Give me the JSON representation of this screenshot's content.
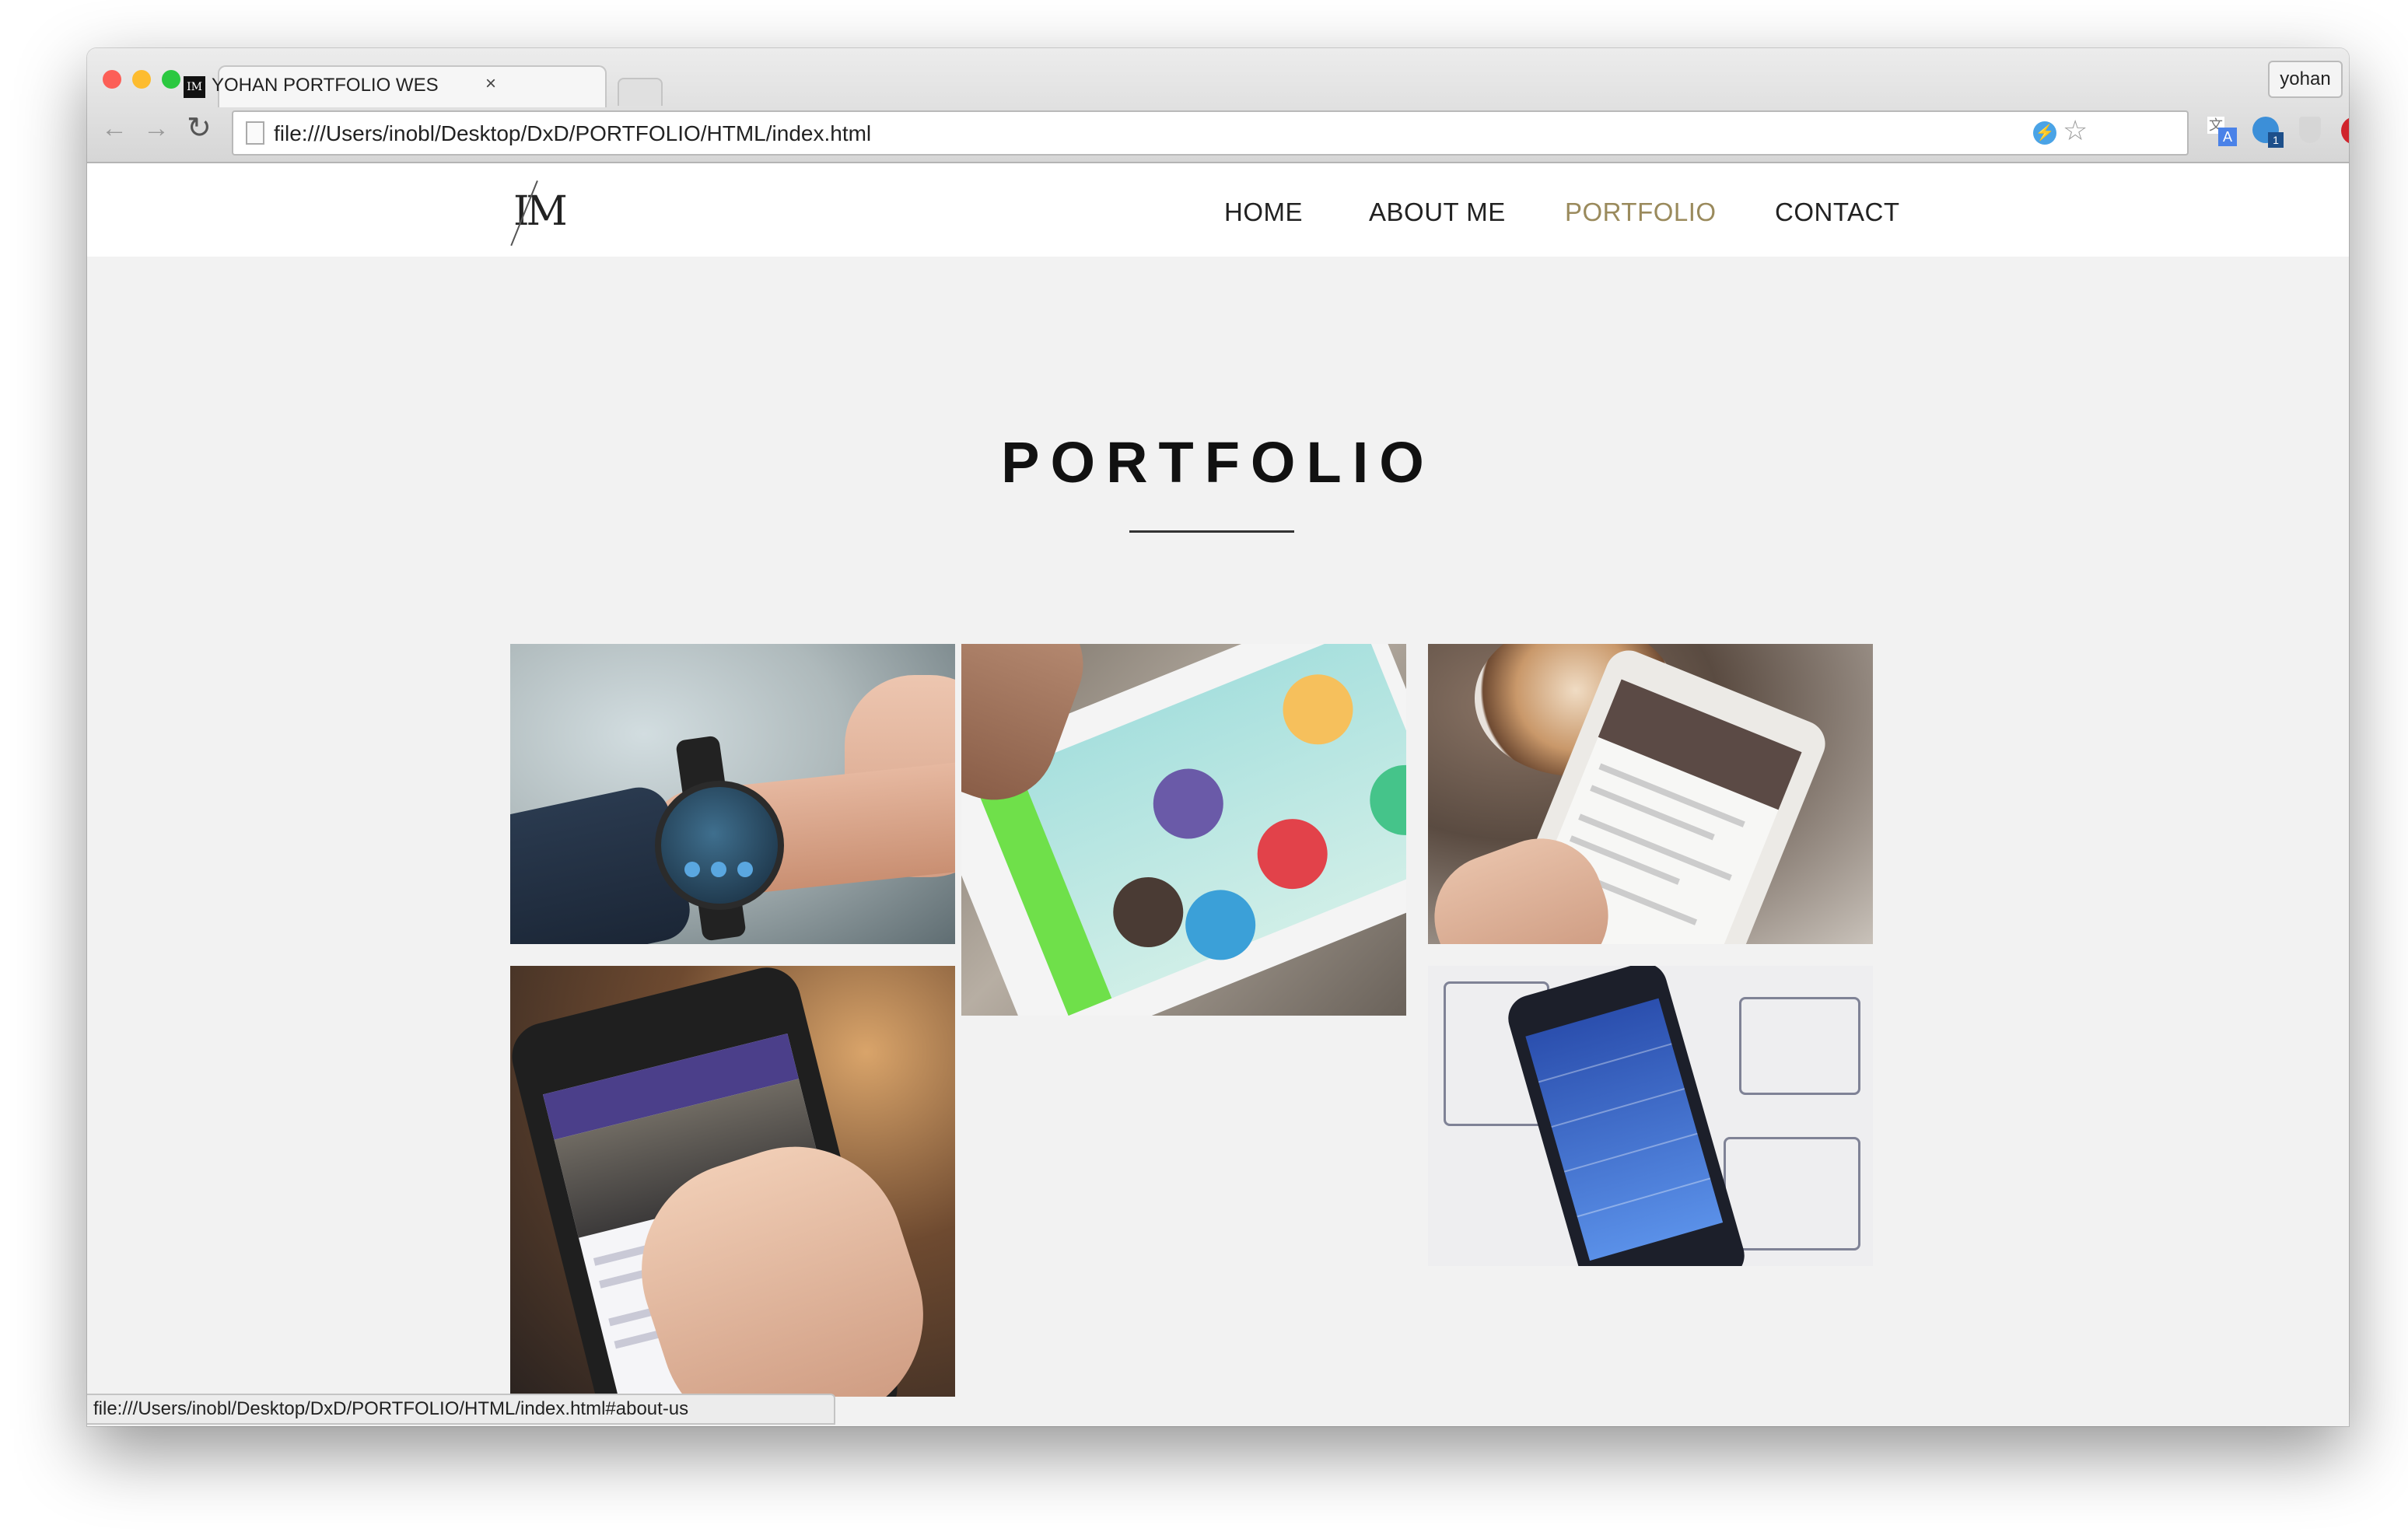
{
  "browser": {
    "tab_title": "YOHAN PORTFOLIO WESI",
    "tab_favicon": "IM",
    "tab_close": "×",
    "profile_name": "yohan",
    "url": "file:///Users/inobl/Desktop/DxD/PORTFOLIO/HTML/index.html",
    "back_icon": "←",
    "forward_icon": "→",
    "reload_icon": "↻",
    "star_icon": "☆",
    "extension_icons": [
      "bolt-icon",
      "translate-icon",
      "globe-icon",
      "shield-icon",
      "pinterest-icon"
    ],
    "status_url": "file:///Users/inobl/Desktop/DxD/PORTFOLIO/HTML/index.html#about-us",
    "traffic_lights": [
      "#fc5f57",
      "#fdbc2f",
      "#2bc840"
    ]
  },
  "site": {
    "logo": "IM",
    "nav": [
      {
        "label": "HOME",
        "active": false
      },
      {
        "label": "ABOUT ME",
        "active": false
      },
      {
        "label": "PORTFOLIO",
        "active": true
      },
      {
        "label": "CONTACT",
        "active": false
      }
    ],
    "accent_color": "#9a8a5c",
    "section_title": "PORTFOLIO",
    "tiles": [
      {
        "name": "smartwatch-app-image"
      },
      {
        "name": "game-app-image"
      },
      {
        "name": "calendar-app-image"
      },
      {
        "name": "cross-social-app-image"
      },
      {
        "name": "dashboard-app-image"
      }
    ]
  },
  "ext_labels": {
    "bolt": "⚡",
    "translate_g": "文",
    "translate_a": "A",
    "globe_badge": "1",
    "pinterest": "P"
  }
}
